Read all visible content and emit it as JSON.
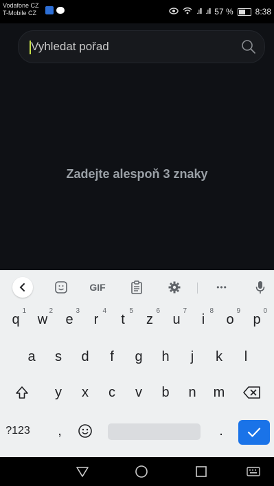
{
  "statusbar": {
    "carrier1": "Vodafone CZ",
    "carrier2": "T-Mobile CZ",
    "battery": "57 %",
    "time": "8:38",
    "battery_level": 0.57
  },
  "search": {
    "placeholder": "Vyhledat pořad",
    "value": ""
  },
  "hint": "Zadejte alespoň 3 znaky",
  "keyboard": {
    "toolbar": {
      "gif": "GIF",
      "more": "•••"
    },
    "rows": [
      {
        "keys": [
          {
            "label": "q",
            "sup": "1"
          },
          {
            "label": "w",
            "sup": "2"
          },
          {
            "label": "e",
            "sup": "3"
          },
          {
            "label": "r",
            "sup": "4"
          },
          {
            "label": "t",
            "sup": "5"
          },
          {
            "label": "z",
            "sup": "6"
          },
          {
            "label": "u",
            "sup": "7"
          },
          {
            "label": "i",
            "sup": "8"
          },
          {
            "label": "o",
            "sup": "9"
          },
          {
            "label": "p",
            "sup": "0"
          }
        ]
      },
      {
        "keys": [
          {
            "label": "a"
          },
          {
            "label": "s"
          },
          {
            "label": "d"
          },
          {
            "label": "f"
          },
          {
            "label": "g"
          },
          {
            "label": "h"
          },
          {
            "label": "j"
          },
          {
            "label": "k"
          },
          {
            "label": "l"
          }
        ]
      },
      {
        "keys": [
          {
            "label": "y"
          },
          {
            "label": "x"
          },
          {
            "label": "c"
          },
          {
            "label": "v"
          },
          {
            "label": "b"
          },
          {
            "label": "n"
          },
          {
            "label": "m"
          }
        ]
      }
    ],
    "bottom": {
      "symbols": "?123",
      "comma": ",",
      "period": "."
    }
  },
  "colors": {
    "background": "#0f1115",
    "accent": "#1a73e8",
    "hint_text": "#9aa0a6"
  }
}
